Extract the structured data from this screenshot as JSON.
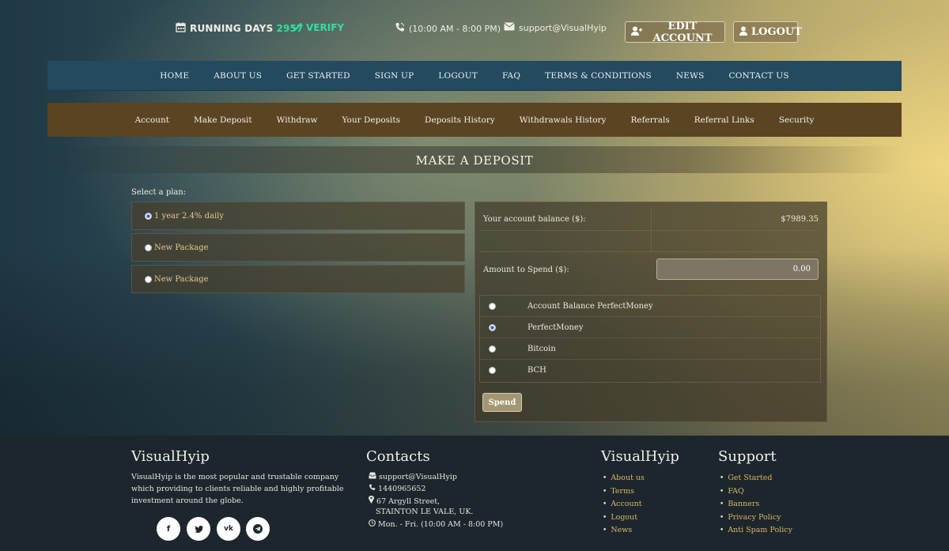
{
  "topbar": {
    "running_label": "RUNNING DAYS",
    "running_days": "2957",
    "verify_label": "VERIFY",
    "hours": "(10:00 AM - 8:00 PM)",
    "email": "support@VisualHyip",
    "edit_account": "EDIT ACCOUNT",
    "logout": "LOGOUT",
    "icons": [
      "calendar-icon",
      "check-icon",
      "phone-icon",
      "mail-icon",
      "user-plus-icon",
      "user-icon"
    ]
  },
  "main_nav": [
    "HOME",
    "ABOUT US",
    "GET STARTED",
    "SIGN UP",
    "LOGOUT",
    "FAQ",
    "TERMS & CONDITIONS",
    "NEWS",
    "CONTACT US"
  ],
  "account_nav": [
    "Account",
    "Make Deposit",
    "Withdraw",
    "Your Deposits",
    "Deposits History",
    "Withdrawals History",
    "Referrals",
    "Referral Links",
    "Security"
  ],
  "page_title": "MAKE A DEPOSIT",
  "plans": {
    "label": "Select a plan:",
    "options": [
      {
        "label": "1 year 2.4% daily",
        "selected": true
      },
      {
        "label": "New Package",
        "selected": false
      },
      {
        "label": "New Package",
        "selected": false
      }
    ]
  },
  "deposit": {
    "balance_label": "Your account balance ($):",
    "balance_value": "$7989.35",
    "amount_label": "Amount to Spend ($):",
    "amount_value": "0.00",
    "methods": [
      {
        "label": "Account Balance PerfectMoney",
        "selected": false
      },
      {
        "label": "PerfectMoney",
        "selected": true
      },
      {
        "label": "Bitcoin",
        "selected": false
      },
      {
        "label": "BCH",
        "selected": false
      }
    ],
    "spend_label": "Spend"
  },
  "footer": {
    "about_title": "VisualHyip",
    "about_text": "VisualHyip is the most popular and trustable company which providing to clients reliable and highly profitable investment around the globe.",
    "social": [
      "f",
      "t",
      "vk",
      "tg"
    ],
    "social_icons": [
      "facebook-icon",
      "twitter-icon",
      "vk-icon",
      "telegram-icon"
    ],
    "contacts_title": "Contacts",
    "contact_email": "support@VisualHyip",
    "contact_phone": "1440965652",
    "contact_address_1": "67 Argyll Street,",
    "contact_address_2": "STAINTON LE VALE, UK.",
    "contact_hours": "Mon. - Fri. (10:00 AM - 8:00 PM)",
    "links_title": "VisualHyip",
    "links": [
      "About us",
      "Terms",
      "Account",
      "Logout",
      "News"
    ],
    "support_title": "Support",
    "support_links": [
      "Get Started",
      "FAQ",
      "Banners",
      "Privacy Policy",
      "Anti Spam Policy"
    ]
  },
  "colors": {
    "main_nav_bg": "#234a5f",
    "account_nav_bg": "#5a4422",
    "accent_green": "#2fe0a0",
    "link_gold": "#d9b56a",
    "footer_bg": "#1c262c"
  }
}
